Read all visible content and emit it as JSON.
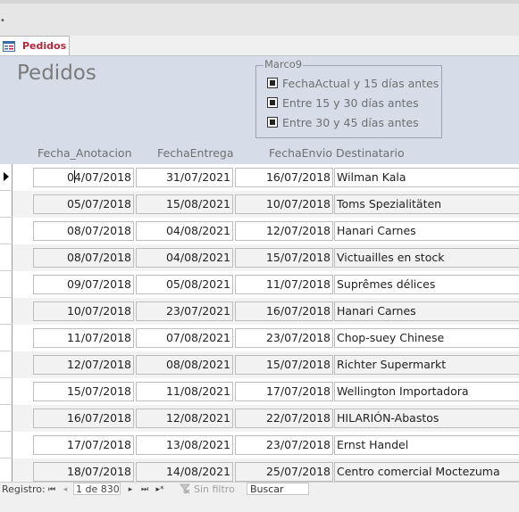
{
  "window": {
    "top_fragment": "•"
  },
  "tab": {
    "label": "Pedidos",
    "icon": "form-icon"
  },
  "form": {
    "title": "Pedidos",
    "frame": {
      "legend": "Marco9",
      "options": [
        {
          "label": "FechaActual y 15 días antes",
          "checked": true
        },
        {
          "label": "Entre 15 y 30 días antes",
          "checked": true
        },
        {
          "label": "Entre 30 y 45 días antes",
          "checked": true
        }
      ]
    },
    "columns": {
      "fecha_anotacion": "Fecha_Anotacion",
      "fecha_entrega": "FechaEntrega",
      "fecha_envio": "FechaEnvio",
      "destinatario": "Destinatario"
    },
    "rows": [
      {
        "fecha_anotacion_a": "0",
        "fecha_anotacion_b": "4/07/2018",
        "fecha_entrega": "31/07/2021",
        "fecha_envio": "16/07/2018",
        "destinatario": "Wilman Kala"
      },
      {
        "fecha_anotacion": "05/07/2018",
        "fecha_entrega": "15/08/2021",
        "fecha_envio": "10/07/2018",
        "destinatario": "Toms Spezialitäten"
      },
      {
        "fecha_anotacion": "08/07/2018",
        "fecha_entrega": "04/08/2021",
        "fecha_envio": "12/07/2018",
        "destinatario": "Hanari Carnes"
      },
      {
        "fecha_anotacion": "08/07/2018",
        "fecha_entrega": "04/08/2021",
        "fecha_envio": "15/07/2018",
        "destinatario": "Victuailles en stock"
      },
      {
        "fecha_anotacion": "09/07/2018",
        "fecha_entrega": "05/08/2021",
        "fecha_envio": "11/07/2018",
        "destinatario": "Suprêmes délices"
      },
      {
        "fecha_anotacion": "10/07/2018",
        "fecha_entrega": "23/07/2021",
        "fecha_envio": "16/07/2018",
        "destinatario": "Hanari Carnes"
      },
      {
        "fecha_anotacion": "11/07/2018",
        "fecha_entrega": "07/08/2021",
        "fecha_envio": "23/07/2018",
        "destinatario": "Chop-suey Chinese"
      },
      {
        "fecha_anotacion": "12/07/2018",
        "fecha_entrega": "08/08/2021",
        "fecha_envio": "15/07/2018",
        "destinatario": "Richter Supermarkt"
      },
      {
        "fecha_anotacion": "15/07/2018",
        "fecha_entrega": "11/08/2021",
        "fecha_envio": "17/07/2018",
        "destinatario": "Wellington Importadora"
      },
      {
        "fecha_anotacion": "16/07/2018",
        "fecha_entrega": "12/08/2021",
        "fecha_envio": "22/07/2018",
        "destinatario": "HILARIÓN-Abastos"
      },
      {
        "fecha_anotacion": "17/07/2018",
        "fecha_entrega": "13/08/2021",
        "fecha_envio": "23/07/2018",
        "destinatario": "Ernst Handel"
      },
      {
        "fecha_anotacion": "18/07/2018",
        "fecha_entrega": "14/08/2021",
        "fecha_envio": "25/07/2018",
        "destinatario": "Centro comercial Moctezuma"
      }
    ]
  },
  "navigation": {
    "label": "Registro:",
    "first": "⏮",
    "prev": "◂",
    "position": "1 de 830",
    "next": "▸",
    "last": "⏭",
    "new": "▸*",
    "filter": "Sin filtro",
    "search": "Buscar"
  },
  "colors": {
    "accent": "#b4243a",
    "header_bg": "#d6dde9",
    "alt_row": "#f2f2f2"
  }
}
